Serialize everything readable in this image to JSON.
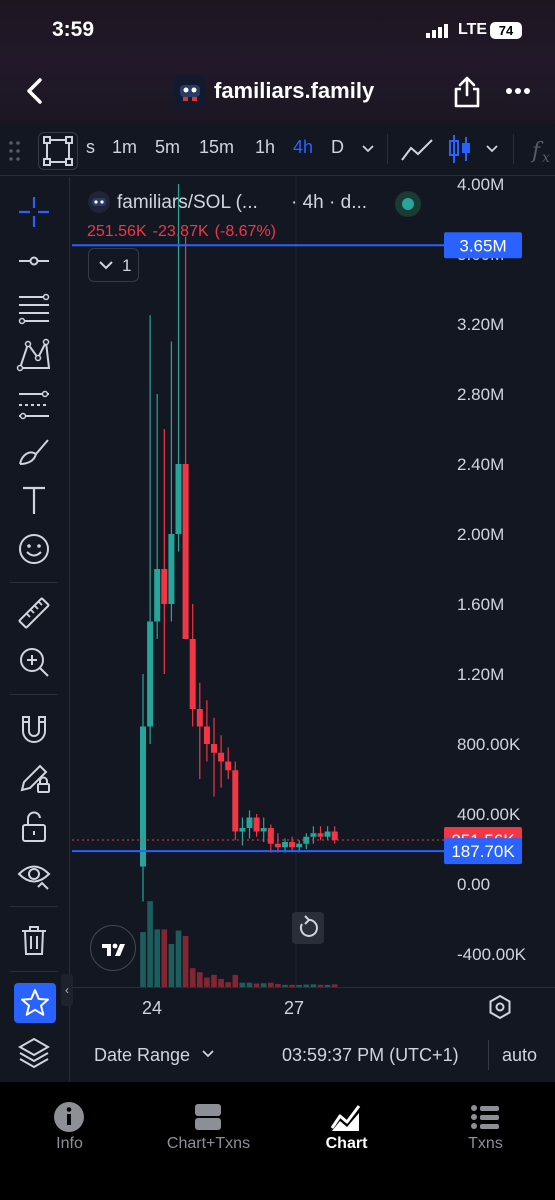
{
  "status_bar": {
    "time": "3:59",
    "network": "LTE",
    "battery": "74"
  },
  "header": {
    "title": "familiars.family"
  },
  "toolbar": {
    "timeframes": [
      {
        "label": "s",
        "active": false
      },
      {
        "label": "1m",
        "active": false
      },
      {
        "label": "5m",
        "active": false
      },
      {
        "label": "15m",
        "active": false
      },
      {
        "label": "1h",
        "active": false
      },
      {
        "label": "4h",
        "active": true
      },
      {
        "label": "D",
        "active": false
      }
    ]
  },
  "legend": {
    "symbol": "familiars/SOL (...",
    "interval": "· 4h · d...",
    "ohlc_value": "251.56K",
    "ohlc_change": "-23.87K",
    "ohlc_change_pct": "(-8.67%)",
    "indicator_count": "1"
  },
  "price_axis": {
    "labels": [
      "4.00M",
      "3.60M",
      "3.20M",
      "2.80M",
      "2.40M",
      "2.00M",
      "1.60M",
      "1.20M",
      "800.00K",
      "400.00K",
      "0.00",
      "-400.00K"
    ],
    "markers": [
      {
        "label": "3.65M",
        "value": 3650000,
        "color": "#2962ff"
      },
      {
        "label": "251.56K",
        "value": 251560,
        "color": "#f23645"
      },
      {
        "label": "187.70K",
        "value": 187700,
        "color": "#2962ff"
      }
    ]
  },
  "chart_data": {
    "type": "candlestick",
    "x_ticks": [
      "24",
      "27"
    ],
    "y_range": [
      -400000,
      4000000
    ],
    "horizontal_lines": [
      3650000,
      187700
    ],
    "current_price": 251560,
    "colors": {
      "up": "#26a69a",
      "down": "#f23645",
      "line": "#2962ff"
    },
    "candles": [
      {
        "o": 100000,
        "h": 1200000,
        "l": -100000,
        "c": 900000
      },
      {
        "o": 900000,
        "h": 3250000,
        "l": 800000,
        "c": 1500000
      },
      {
        "o": 1500000,
        "h": 2800000,
        "l": 1400000,
        "c": 1800000
      },
      {
        "o": 1800000,
        "h": 2600000,
        "l": 1200000,
        "c": 1600000
      },
      {
        "o": 1600000,
        "h": 3100000,
        "l": 1500000,
        "c": 2000000
      },
      {
        "o": 2000000,
        "h": 4000000,
        "l": 1900000,
        "c": 2400000
      },
      {
        "o": 2400000,
        "h": 3700000,
        "l": 1800000,
        "c": 1400000
      },
      {
        "o": 1400000,
        "h": 1600000,
        "l": 900000,
        "c": 1000000
      },
      {
        "o": 1000000,
        "h": 1150000,
        "l": 600000,
        "c": 900000
      },
      {
        "o": 900000,
        "h": 1050000,
        "l": 700000,
        "c": 800000
      },
      {
        "o": 800000,
        "h": 950000,
        "l": 500000,
        "c": 750000
      },
      {
        "o": 750000,
        "h": 850000,
        "l": 550000,
        "c": 700000
      },
      {
        "o": 700000,
        "h": 780000,
        "l": 600000,
        "c": 650000
      },
      {
        "o": 650000,
        "h": 700000,
        "l": 250000,
        "c": 300000
      },
      {
        "o": 300000,
        "h": 380000,
        "l": 220000,
        "c": 320000
      },
      {
        "o": 320000,
        "h": 420000,
        "l": 260000,
        "c": 380000
      },
      {
        "o": 380000,
        "h": 400000,
        "l": 270000,
        "c": 300000
      },
      {
        "o": 300000,
        "h": 380000,
        "l": 240000,
        "c": 320000
      },
      {
        "o": 320000,
        "h": 340000,
        "l": 180000,
        "c": 230000
      },
      {
        "o": 230000,
        "h": 290000,
        "l": 180000,
        "c": 210000
      },
      {
        "o": 210000,
        "h": 260000,
        "l": 180000,
        "c": 240000
      },
      {
        "o": 240000,
        "h": 270000,
        "l": 190000,
        "c": 210000
      },
      {
        "o": 210000,
        "h": 250000,
        "l": 180000,
        "c": 230000
      },
      {
        "o": 230000,
        "h": 290000,
        "l": 200000,
        "c": 270000
      },
      {
        "o": 270000,
        "h": 330000,
        "l": 230000,
        "c": 290000
      },
      {
        "o": 290000,
        "h": 330000,
        "l": 250000,
        "c": 270000
      },
      {
        "o": 270000,
        "h": 330000,
        "l": 250000,
        "c": 300000
      },
      {
        "o": 300000,
        "h": 330000,
        "l": 230000,
        "c": 252000
      }
    ]
  },
  "x_axis": {
    "labels": [
      "24",
      "27"
    ]
  },
  "bottom_bar": {
    "date_range": "Date Range",
    "clock": "03:59:37 PM (UTC+1)",
    "scale": "auto"
  },
  "tabs": [
    {
      "label": "Info",
      "active": false
    },
    {
      "label": "Chart+Txns",
      "active": false
    },
    {
      "label": "Chart",
      "active": true
    },
    {
      "label": "Txns",
      "active": false
    }
  ]
}
